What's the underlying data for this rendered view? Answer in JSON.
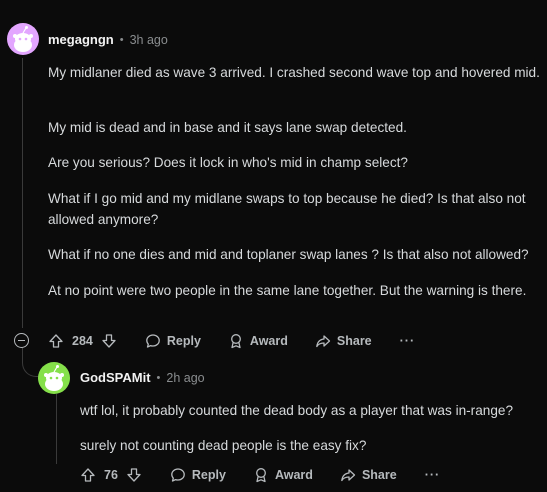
{
  "comment1": {
    "author": "megagngn",
    "time": "3h ago",
    "paragraphs": [
      "My midlaner died as wave 3 arrived. I crashed second wave top and hovered mid.",
      "My mid is dead and in base and it says lane swap detected.",
      "Are you serious? Does it lock in who's mid in champ select?",
      "What if I go mid and my midlane swaps to top because he died? Is that also not allowed anymore?",
      "What if no one dies and mid and toplaner swap lanes ? Is that also not allowed?",
      "At no point were two people in the same lane together. But the warning is there."
    ],
    "votes": "284",
    "reply_label": "Reply",
    "award_label": "Award",
    "share_label": "Share",
    "more_label": "···",
    "avatar_color": "#e3a6ff"
  },
  "comment2": {
    "author": "GodSPAMit",
    "time": "2h ago",
    "paragraphs": [
      "wtf lol, it probably counted the dead body as a player that was in-range?",
      "surely not counting dead people is the easy fix?"
    ],
    "votes": "76",
    "reply_label": "Reply",
    "award_label": "Award",
    "share_label": "Share",
    "more_label": "···",
    "avatar_color": "#85e04a"
  },
  "separator": "•"
}
